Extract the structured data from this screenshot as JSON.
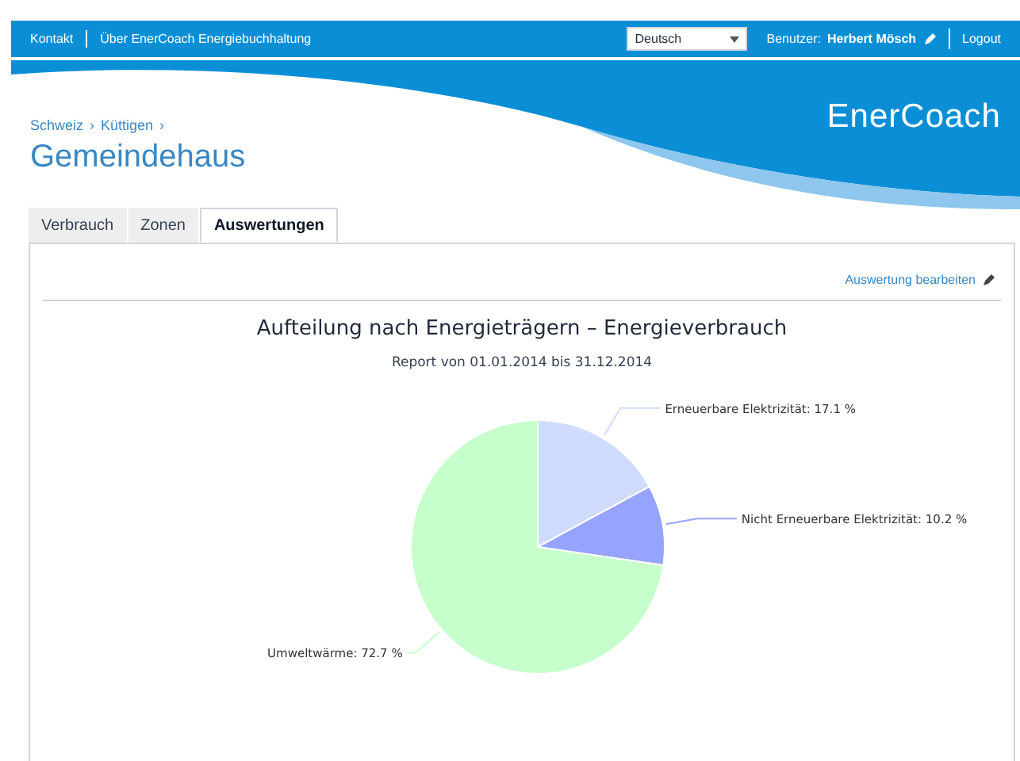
{
  "top_bar": {
    "links": [
      "Kontakt",
      "Über EnerCoach Energiebuchhaltung"
    ],
    "language": "Deutsch",
    "user_label": "Benutzer:",
    "user_name": "Herbert Mösch",
    "logout": "Logout"
  },
  "logo": "EnerCoach",
  "breadcrumb": [
    "Schweiz",
    "Küttigen"
  ],
  "breadcrumb_separator": "›",
  "page_title": "Gemeindehaus",
  "tabs": [
    {
      "label": "Verbrauch",
      "selected": false
    },
    {
      "label": "Zonen",
      "selected": false
    },
    {
      "label": "Auswertungen",
      "selected": true
    }
  ],
  "edit_link": "Auswertung bearbeiten",
  "chart_data": {
    "type": "pie",
    "title": "Aufteilung nach Energieträgern – Energieverbrauch",
    "subtitle": "Report von 01.01.2014 bis 31.12.2014",
    "categories": [
      "Erneuerbare Elektrizität",
      "Nicht Erneuerbare Elektrizität",
      "Umweltwärme"
    ],
    "series": [
      {
        "colors": [
          "#d0dcff",
          "#96a4ff",
          "#c6ffcc"
        ],
        "values": [
          17.1,
          10.2,
          72.7
        ]
      }
    ],
    "value_labels": [
      ": 17.1 %",
      ": 10.2 %",
      ": 72.7 %"
    ]
  }
}
